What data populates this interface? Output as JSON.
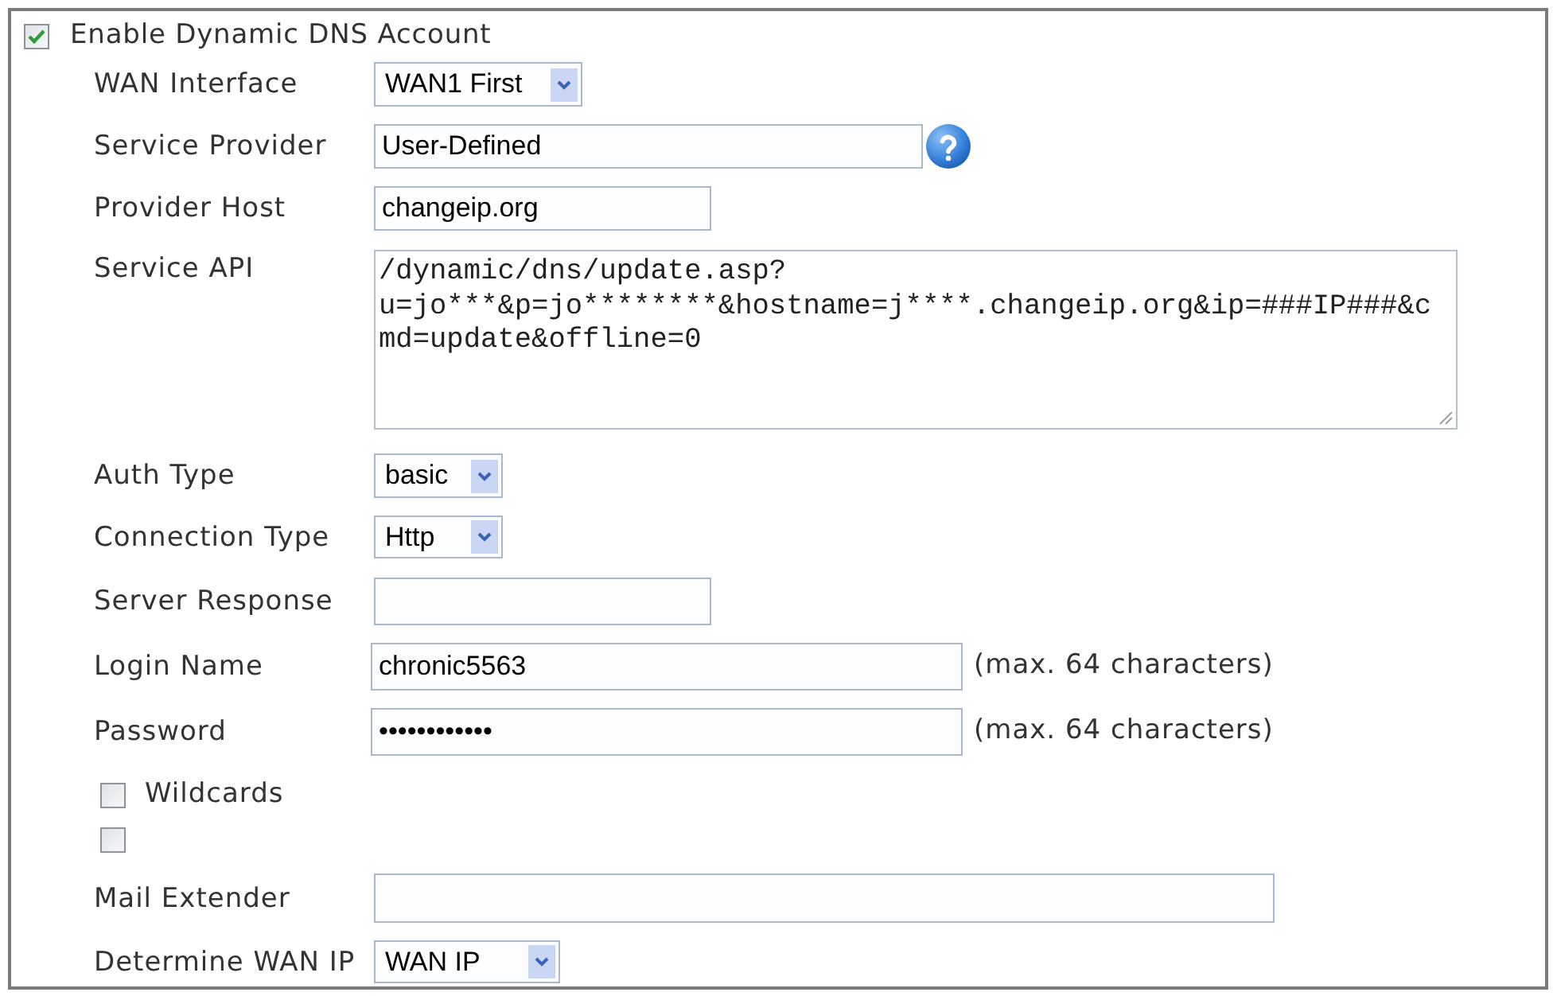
{
  "enable_account": {
    "label": "Enable Dynamic DNS Account",
    "checked": true
  },
  "fields": [
    {
      "kind": "select",
      "label": "WAN Interface",
      "value": "WAN1 First"
    },
    {
      "kind": "input",
      "label": "Service Provider",
      "value": "User-Defined",
      "help": true
    },
    {
      "kind": "input",
      "label": "Provider Host",
      "value": "changeip.org"
    },
    {
      "kind": "textarea",
      "label": "Service API",
      "lines": [
        "/dynamic/dns/update.asp?",
        "u=jo***&p=jo********&hostname=j****.changeip.org&ip=###IP###&c",
        "md=update&offline=0"
      ]
    },
    {
      "kind": "select",
      "label": "Auth Type",
      "value": "basic"
    },
    {
      "kind": "select",
      "label": "Connection Type",
      "value": "Http"
    },
    {
      "kind": "input",
      "label": "Server Response"
    },
    {
      "kind": "input",
      "label": "Login Name",
      "value": "chronic5563",
      "hint": "(max. 64 characters)"
    },
    {
      "kind": "password",
      "label": "Password",
      "value": "••••••••••••",
      "hint": "(max. 64 characters)"
    },
    {
      "kind": "checkbox",
      "label": "Wildcards",
      "checked": false
    },
    {
      "kind": "checkbox",
      "checked": false
    },
    {
      "kind": "input",
      "label": "Mail Extender"
    },
    {
      "kind": "select",
      "label": "Determine WAN IP",
      "value": "WAN IP"
    }
  ]
}
